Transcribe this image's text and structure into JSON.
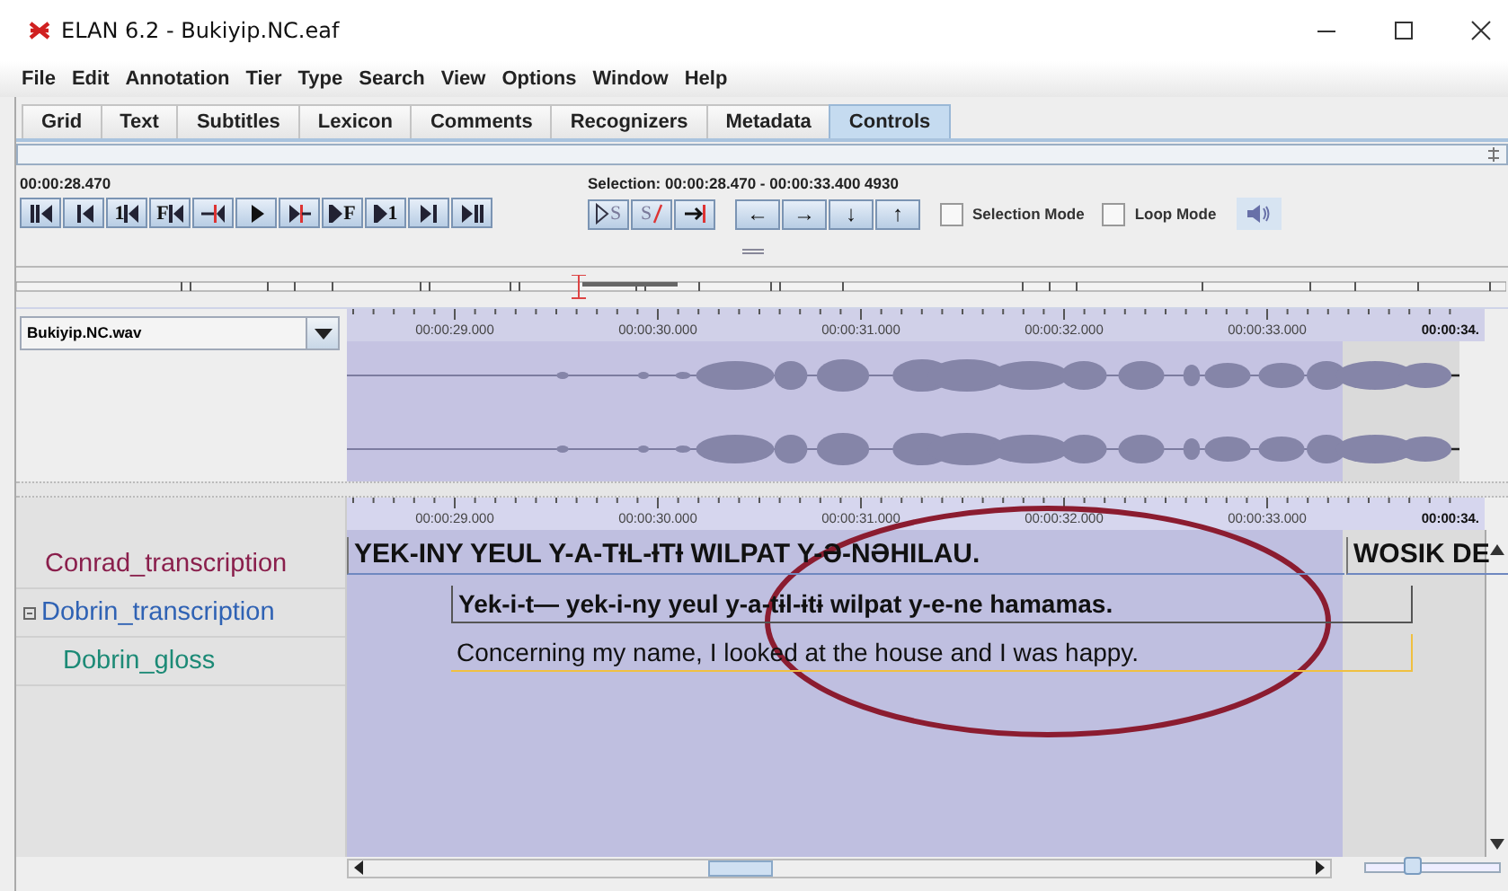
{
  "window": {
    "title": "ELAN 6.2 - Bukiyip.NC.eaf"
  },
  "menu": [
    "File",
    "Edit",
    "Annotation",
    "Tier",
    "Type",
    "Search",
    "View",
    "Options",
    "Window",
    "Help"
  ],
  "tabs": [
    {
      "label": "Grid",
      "selected": false
    },
    {
      "label": "Text",
      "selected": false
    },
    {
      "label": "Subtitles",
      "selected": false
    },
    {
      "label": "Lexicon",
      "selected": false
    },
    {
      "label": "Comments",
      "selected": false
    },
    {
      "label": "Recognizers",
      "selected": false
    },
    {
      "label": "Metadata",
      "selected": false
    },
    {
      "label": "Controls",
      "selected": true
    }
  ],
  "media_time": "00:00:28.470",
  "selection_info": "Selection: 00:00:28.470 - 00:00:33.400  4930",
  "transport_buttons": [
    {
      "kind": "bar-left"
    },
    {
      "kind": "left"
    },
    {
      "kind": "text-left",
      "text": "1"
    },
    {
      "kind": "text-left",
      "text": "F"
    },
    {
      "kind": "cursor-left"
    },
    {
      "kind": "play"
    },
    {
      "kind": "play-cursor"
    },
    {
      "kind": "text-right",
      "text": "F"
    },
    {
      "kind": "text-right",
      "text": "1"
    },
    {
      "kind": "right"
    },
    {
      "kind": "right-bar"
    }
  ],
  "selection_buttons": [
    {
      "kind": "play-selection",
      "text": "S"
    },
    {
      "kind": "clear-selection",
      "text": "S"
    },
    {
      "kind": "to-end"
    }
  ],
  "arrow_buttons": [
    "←",
    "→",
    "↓",
    "↑"
  ],
  "checkboxes": [
    {
      "label": "Selection Mode",
      "checked": false
    },
    {
      "label": "Loop Mode",
      "checked": false
    }
  ],
  "media_file": "Bukiyip.NC.wav",
  "zoom_slider": {
    "level": 0.35
  },
  "waveform_ruler": [
    "00:00:29.000",
    "00:00:30.000",
    "00:00:31.000",
    "00:00:32.000",
    "00:00:33.000",
    "00:00:34."
  ],
  "annotation_ruler": [
    "00:00:29.000",
    "00:00:30.000",
    "00:00:31.000",
    "00:00:32.000",
    "00:00:33.000",
    "00:00:34."
  ],
  "tiers": [
    {
      "name": "Conrad_transcription",
      "color": "#8a1f4c",
      "annotations": [
        "YEK-INY YEUL Y-A-TƗL-ƗTƗ WILPAT Y-Ə-NƏHILAU.",
        "WOSIK DE"
      ]
    },
    {
      "name": "Dobrin_transcription",
      "color": "#2f62b4",
      "annotations": [
        "Yek-i-t— yek-i-ny yeul y-a-tɨl-ɨtɨ wilpat y-e-ne hamamas."
      ],
      "children": [
        {
          "name": "Dobrin_gloss",
          "color": "#1c8a76",
          "annotations": [
            "Concerning my name, I looked at the house and I was happy."
          ]
        }
      ]
    }
  ]
}
